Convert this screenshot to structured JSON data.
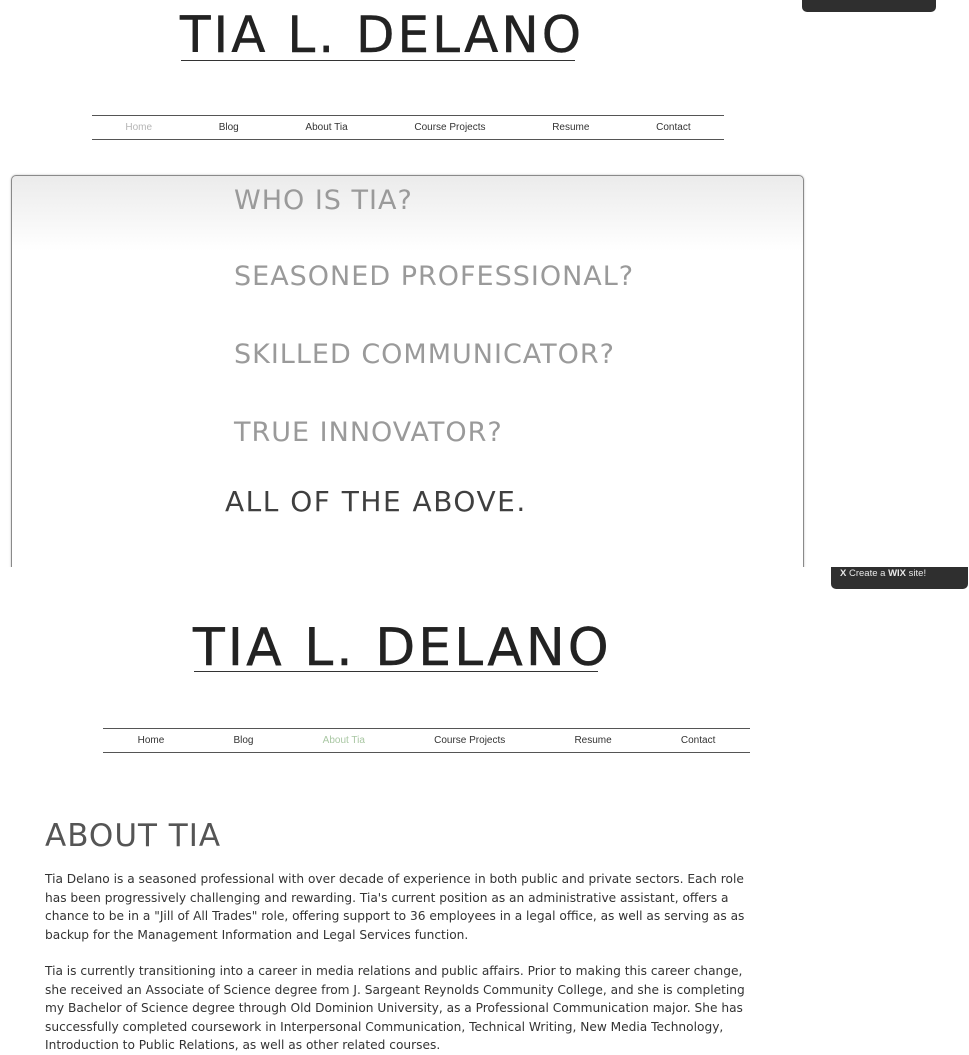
{
  "top": {
    "site_title": "TIA L. DELANO",
    "nav": [
      "Home",
      "Blog",
      "About Tia",
      "Course Projects",
      "Resume",
      "Contact"
    ],
    "hero_lines": [
      "WHO IS TIA?",
      "SEASONED PROFESSIONAL?",
      "SKILLED COMMUNICATOR?",
      "TRUE INNOVATOR?"
    ],
    "hero_final": "ALL OF THE ABOVE."
  },
  "wix_banner": {
    "close_glyph": "X",
    "label_prefix": "Create a",
    "label_brand": "WIX",
    "label_suffix": "site!"
  },
  "bottom": {
    "site_title": "TIA L. DELANO",
    "nav": [
      "Home",
      "Blog",
      "About Tia",
      "Course Projects",
      "Resume",
      "Contact"
    ],
    "page_heading": "ABOUT TIA",
    "paragraphs": [
      "Tia Delano is a seasoned professional with over decade of experience in both public and private sectors. Each role has been progressively challenging and rewarding. Tia's current position as an administrative assistant, offers a chance to be in a \"Jill of All Trades\" role, offering support to 36 employees in a legal office, as well as serving as as backup for the Management Information and Legal Services function.",
      "Tia is currently transitioning into a career in media relations and public affairs. Prior to making this career change, she received an Associate of Science degree from J. Sargeant Reynolds Community College, and she is completing my Bachelor of Science degree through Old Dominion University, as a Professional Communication major. She has successfully completed coursework in Interpersonal Communication, Technical Writing, New Media Technology, Introduction to Public Relations, as well as other related courses."
    ]
  },
  "colors": {
    "active_home": "#b5b5b5",
    "active_about": "#a9c7a3",
    "hero_text": "#9a9a9a",
    "hero_final_text": "#3f3f3f",
    "wix_bar": "#2f2f2f"
  }
}
